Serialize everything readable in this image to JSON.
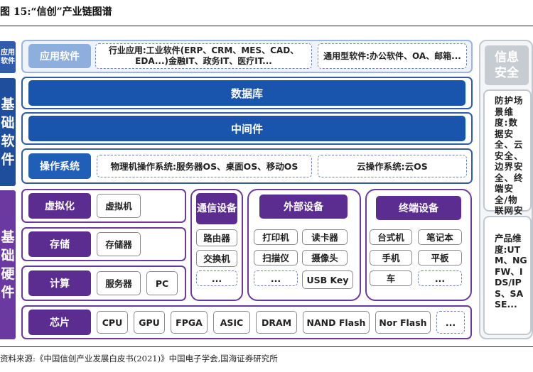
{
  "title": "图 15:“信创”产业链图谱",
  "source": "资料来源:《中国信创产业发展白皮书(2021)》中国电子学会,国海证券研究所",
  "side_labels": {
    "app": "应用软件",
    "base": "基础软件",
    "hw": "基础硬件"
  },
  "app_layer": {
    "label": "应用软件",
    "industry": "行业应用:工业软件(ERP、CRM、MES、CAD、EDA...)金融IT、政务IT、医疗IT...",
    "general": "通用型软件:办公软件、OA、邮箱..."
  },
  "database": "数据库",
  "middleware": "中间件",
  "os_layer": {
    "label": "操作系统",
    "physical": "物理机操作系统:服务器OS、桌面OS、移动OS",
    "cloud": "云操作系统:云OS"
  },
  "virtualization": {
    "label": "虚拟化",
    "item": "虚拟机"
  },
  "storage": {
    "label": "存储",
    "item": "存储器"
  },
  "compute": {
    "label": "计算",
    "items": [
      "服务器",
      "PC"
    ]
  },
  "comm": {
    "label": "通信设备",
    "items": [
      "路由器",
      "交换机",
      "..."
    ]
  },
  "external": {
    "label": "外部设备",
    "items": [
      "打印机",
      "读卡器",
      "扫描仪",
      "摄像头",
      "...",
      "USB Key"
    ]
  },
  "terminal": {
    "label": "终端设备",
    "items": [
      "台式机",
      "笔记本",
      "手机",
      "平板",
      "车",
      "..."
    ]
  },
  "chip": {
    "label": "芯片",
    "items": [
      "CPU",
      "GPU",
      "FPGA",
      "ASIC",
      "DRAM",
      "NAND Flash",
      "Nor Flash",
      "..."
    ]
  },
  "security": {
    "label": "信息安全",
    "scenes": "防护场景维度:数据安全、云安全、边界安全、终端安全/物联网安全",
    "products": "产品维度:UTM、NGFW、IDS/IPS、SASE..."
  }
}
